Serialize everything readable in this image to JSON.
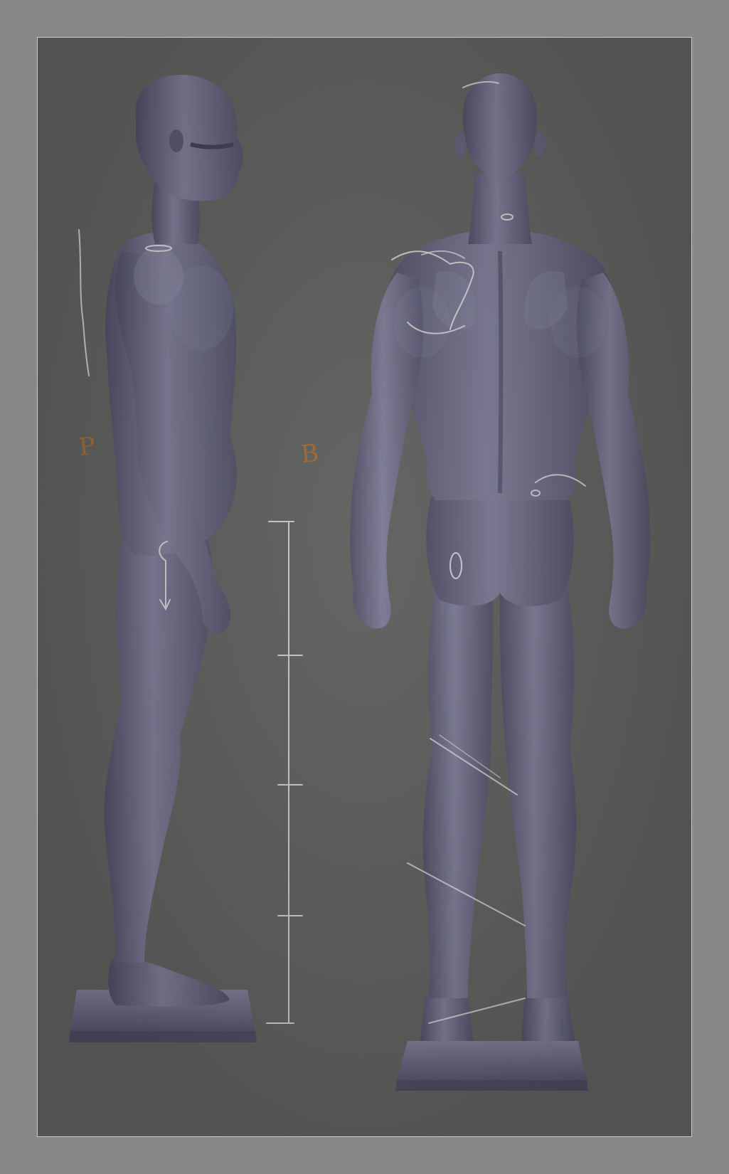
{
  "annotations": {
    "side_letter": "P",
    "back_letter": "B"
  },
  "colors": {
    "background": "#5c5e5c",
    "frame": "#888888",
    "figure": "#6e6d86",
    "figure_shadow": "#4c4b61",
    "figure_highlight": "#8d8ca6",
    "chalk": "#d9d9d9",
    "pencil": "#a8692f"
  }
}
